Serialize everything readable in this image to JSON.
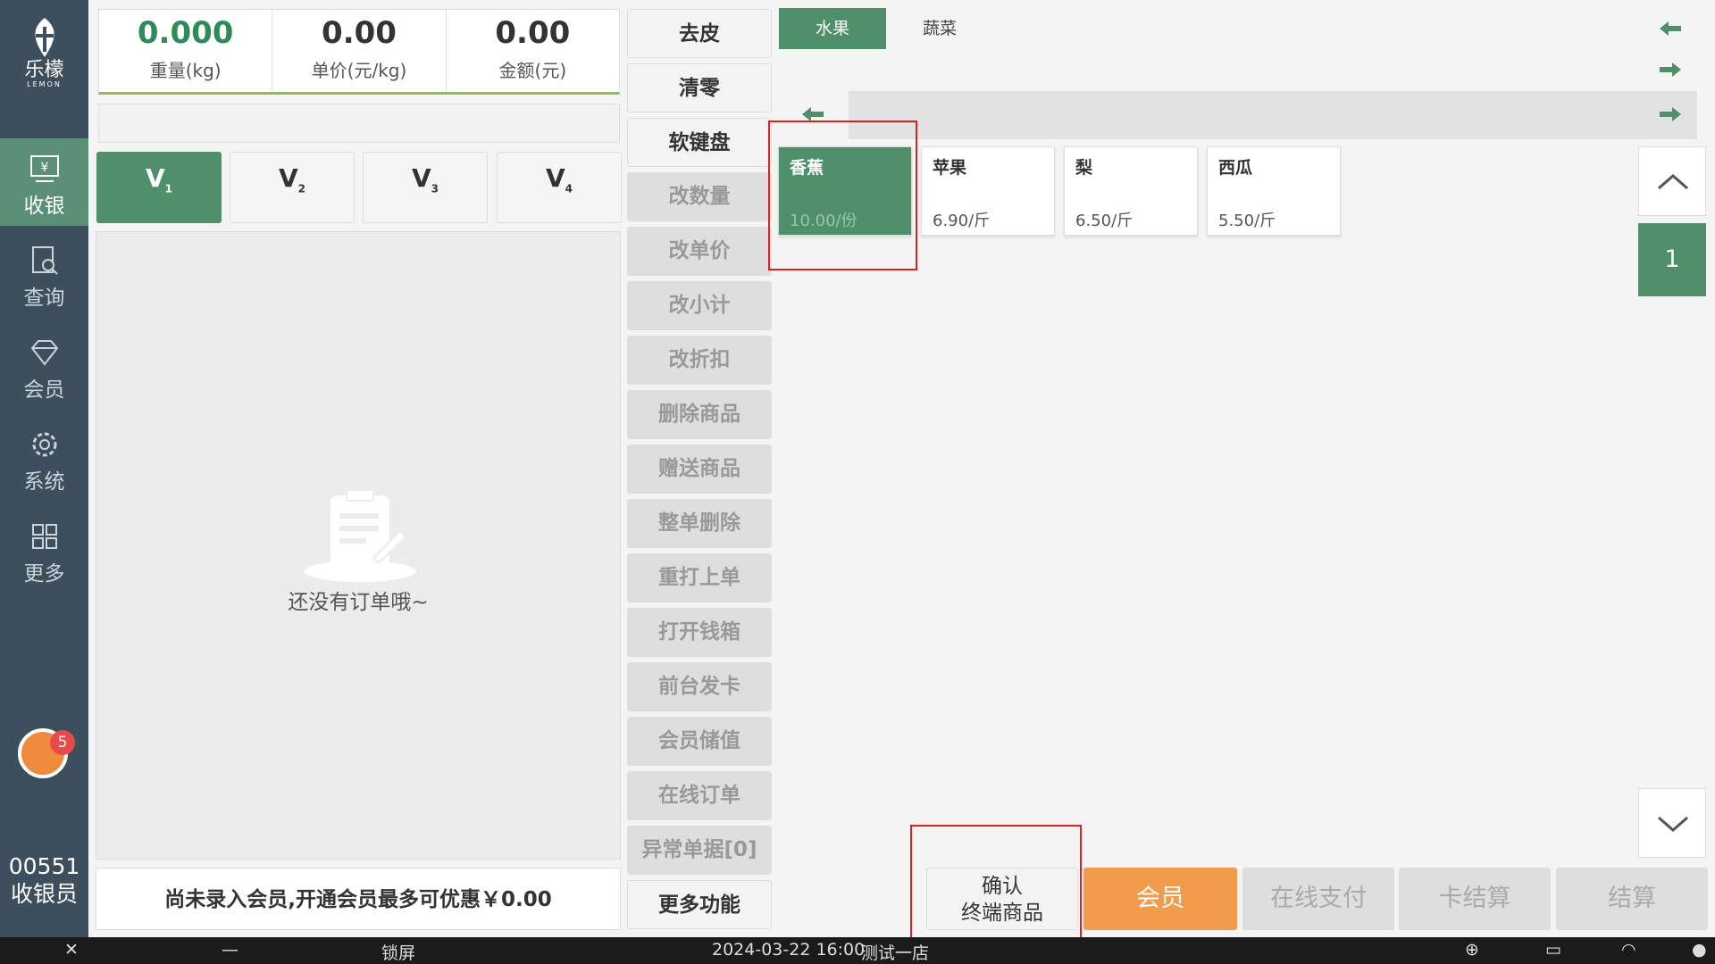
{
  "sidebar": {
    "logo_text": "乐檬",
    "logo_sub": "LEMON",
    "items": [
      {
        "label": "收银",
        "icon": "cashier-icon"
      },
      {
        "label": "查询",
        "icon": "search-document-icon"
      },
      {
        "label": "会员",
        "icon": "diamond-icon"
      },
      {
        "label": "系统",
        "icon": "gear-icon"
      },
      {
        "label": "更多",
        "icon": "grid-icon"
      }
    ],
    "notification_count": "5",
    "cashier_number": "00551",
    "cashier_role": "收银员"
  },
  "scale": {
    "weight_value": "0.000",
    "weight_label": "重量(kg)",
    "unit_price_value": "0.00",
    "unit_price_label": "单价(元/kg)",
    "amount_value": "0.00",
    "amount_label": "金额(元)"
  },
  "vip_levels": [
    {
      "label": "V",
      "sub": "1"
    },
    {
      "label": "V",
      "sub": "2"
    },
    {
      "label": "V",
      "sub": "3"
    },
    {
      "label": "V",
      "sub": "4"
    }
  ],
  "order": {
    "empty_text": "还没有订单哦~",
    "member_hint": "尚未录入会员,开通会员最多可优惠￥0.00"
  },
  "functions": [
    {
      "label": "去皮",
      "enabled": true
    },
    {
      "label": "清零",
      "enabled": true
    },
    {
      "label": "软键盘",
      "enabled": true
    },
    {
      "label": "改数量",
      "enabled": false
    },
    {
      "label": "改单价",
      "enabled": false
    },
    {
      "label": "改小计",
      "enabled": false
    },
    {
      "label": "改折扣",
      "enabled": false
    },
    {
      "label": "删除商品",
      "enabled": false
    },
    {
      "label": "赠送商品",
      "enabled": false
    },
    {
      "label": "整单删除",
      "enabled": false
    },
    {
      "label": "重打上单",
      "enabled": false
    },
    {
      "label": "打开钱箱",
      "enabled": false
    },
    {
      "label": "前台发卡",
      "enabled": false
    },
    {
      "label": "会员储值",
      "enabled": false
    },
    {
      "label": "在线订单",
      "enabled": false
    },
    {
      "label": "异常单据[0]",
      "enabled": false
    },
    {
      "label": "更多功能",
      "enabled": true
    }
  ],
  "categories": [
    {
      "label": "水果",
      "active": true
    },
    {
      "label": "蔬菜",
      "active": false
    }
  ],
  "products": [
    {
      "name": "香蕉",
      "price": "10.00/份"
    },
    {
      "name": "苹果",
      "price": "6.90/斤"
    },
    {
      "name": "梨",
      "price": "6.50/斤"
    },
    {
      "name": "西瓜",
      "price": "5.50/斤"
    }
  ],
  "pagination": {
    "current": "1"
  },
  "actions": {
    "confirm_line1": "确认",
    "confirm_line2": "终端商品",
    "member": "会员",
    "online_pay": "在线支付",
    "card_settle": "卡结算",
    "settle": "结算"
  },
  "taskbar": {
    "lock": "锁屏",
    "datetime": "2024-03-22 16:00",
    "store": "测试一店"
  },
  "colors": {
    "primary_green": "#4f8f6a",
    "sidebar_bg": "#3d4f5c",
    "member_orange": "#f29b4c",
    "highlight_red": "#e02020"
  }
}
